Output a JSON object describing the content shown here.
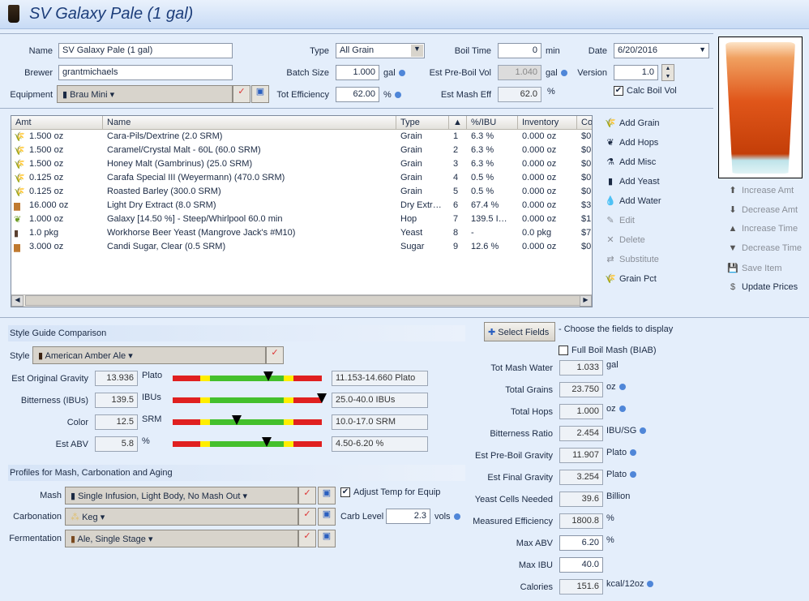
{
  "window": {
    "title": "SV Galaxy Pale (1 gal)",
    "icon": "beer-glass-icon"
  },
  "recipe": {
    "name_label": "Name",
    "name": "SV Galaxy Pale (1 gal)",
    "brewer_label": "Brewer",
    "brewer": "grantmichaels",
    "equipment_label": "Equipment",
    "equipment": "Brau Mini",
    "type_label": "Type",
    "type": "All Grain",
    "batch_label": "Batch Size",
    "batch": "1.000",
    "batch_unit": "gal",
    "eff_label": "Tot Efficiency",
    "eff": "62.00",
    "eff_unit": "%",
    "boil_label": "Boil Time",
    "boil": "0",
    "boil_unit": "min",
    "preboil_label": "Est Pre-Boil Vol",
    "preboil": "1.040",
    "preboil_unit": "gal",
    "mash_eff_label": "Est Mash Eff",
    "mash_eff": "62.0",
    "mash_eff_unit": "%",
    "date_label": "Date",
    "date": "6/20/2016",
    "version_label": "Version",
    "version": "1.0",
    "calc_boil_label": "Calc Boil Vol",
    "calc_boil": true
  },
  "grid": {
    "headers": [
      "Amt",
      "Name",
      "Type",
      "▲",
      "%/IBU",
      "Inventory",
      "Cost"
    ],
    "rows": [
      {
        "icon": "grain-icon",
        "amt": "1.500 oz",
        "name": "Cara-Pils/Dextrine (2.0 SRM)",
        "type": "Grain",
        "n": "1",
        "pct": "6.3 %",
        "inv": "0.000 oz",
        "cost": "$0."
      },
      {
        "icon": "grain-icon",
        "amt": "1.500 oz",
        "name": "Caramel/Crystal Malt - 60L (60.0 SRM)",
        "type": "Grain",
        "n": "2",
        "pct": "6.3 %",
        "inv": "0.000 oz",
        "cost": "$0."
      },
      {
        "icon": "grain-icon",
        "amt": "1.500 oz",
        "name": "Honey Malt (Gambrinus) (25.0 SRM)",
        "type": "Grain",
        "n": "3",
        "pct": "6.3 %",
        "inv": "0.000 oz",
        "cost": "$0."
      },
      {
        "icon": "grain-icon",
        "amt": "0.125 oz",
        "name": "Carafa Special III (Weyermann) (470.0 SRM)",
        "type": "Grain",
        "n": "4",
        "pct": "0.5 %",
        "inv": "0.000 oz",
        "cost": "$0."
      },
      {
        "icon": "grain-icon",
        "amt": "0.125 oz",
        "name": "Roasted Barley (300.0 SRM)",
        "type": "Grain",
        "n": "5",
        "pct": "0.5 %",
        "inv": "0.000 oz",
        "cost": "$0."
      },
      {
        "icon": "extract-bag-icon",
        "amt": "16.000 oz",
        "name": "Light Dry Extract (8.0 SRM)",
        "type": "Dry Extr…",
        "n": "6",
        "pct": "67.4 %",
        "inv": "0.000 oz",
        "cost": "$3."
      },
      {
        "icon": "hop-icon",
        "amt": "1.000 oz",
        "name": "Galaxy [14.50 %] - Steep/Whirlpool  60.0 min",
        "type": "Hop",
        "n": "7",
        "pct": "139.5 I…",
        "inv": "0.000 oz",
        "cost": "$1."
      },
      {
        "icon": "yeast-vial-icon",
        "amt": "1.0 pkg",
        "name": "Workhorse Beer Yeast (Mangrove Jack's #M10)",
        "type": "Yeast",
        "n": "8",
        "pct": "-",
        "inv": "0.0 pkg",
        "cost": "$7."
      },
      {
        "icon": "sugar-bag-icon",
        "amt": "3.000 oz",
        "name": "Candi Sugar, Clear (0.5 SRM)",
        "type": "Sugar",
        "n": "9",
        "pct": "12.6 %",
        "inv": "0.000 oz",
        "cost": "$0."
      }
    ]
  },
  "actions": [
    {
      "label": "Add Grain",
      "icon": "grain-icon",
      "glyph": "🌾",
      "enabled": true
    },
    {
      "label": "Add Hops",
      "icon": "hop-icon",
      "glyph": "❦",
      "enabled": true
    },
    {
      "label": "Add Misc",
      "icon": "misc-icon",
      "glyph": "⚗",
      "enabled": true
    },
    {
      "label": "Add Yeast",
      "icon": "yeast-vial-icon",
      "glyph": "▮",
      "enabled": true
    },
    {
      "label": "Add Water",
      "icon": "water-drop-icon",
      "glyph": "💧",
      "enabled": true
    },
    {
      "label": "Edit",
      "icon": "edit-icon",
      "glyph": "✎",
      "enabled": false
    },
    {
      "label": "Delete",
      "icon": "delete-x-icon",
      "glyph": "✕",
      "enabled": false
    },
    {
      "label": "Substitute",
      "icon": "substitute-arrows-icon",
      "glyph": "⇄",
      "enabled": false
    },
    {
      "label": "Grain Pct",
      "icon": "grain-icon",
      "glyph": "🌾",
      "enabled": true
    }
  ],
  "actions2": [
    {
      "label": "Increase Amt",
      "icon": "arrow-up-icon",
      "glyph": "⬆"
    },
    {
      "label": "Decrease Amt",
      "icon": "arrow-down-icon",
      "glyph": "⬇"
    },
    {
      "label": "Increase Time",
      "icon": "triangle-up-icon",
      "glyph": "▲"
    },
    {
      "label": "Decrease Time",
      "icon": "triangle-down-icon",
      "glyph": "▼"
    },
    {
      "label": "Save Item",
      "icon": "save-icon",
      "glyph": "💾"
    },
    {
      "label": "Update Prices",
      "icon": "dollar-icon",
      "glyph": "$"
    }
  ],
  "beer_color": "#e0561a",
  "style": {
    "section_title": "Style Guide Comparison",
    "style_label": "Style",
    "style": "American Amber Ale",
    "gauges": [
      {
        "label": "Est Original Gravity",
        "value": "13.936",
        "unit": "Plato",
        "range": "11.153-14.660 Plato",
        "v": 13.936,
        "min": 11.153,
        "max": 14.66
      },
      {
        "label": "Bitterness (IBUs)",
        "value": "139.5",
        "unit": "IBUs",
        "range": "25.0-40.0 IBUs",
        "v": 139.5,
        "min": 25,
        "max": 40
      },
      {
        "label": "Color",
        "value": "12.5",
        "unit": "SRM",
        "range": "10.0-17.0 SRM",
        "v": 12.5,
        "min": 10,
        "max": 17
      },
      {
        "label": "Est ABV",
        "value": "5.8",
        "unit": "%",
        "range": "4.50-6.20 %",
        "v": 5.8,
        "min": 4.5,
        "max": 6.2
      }
    ]
  },
  "profiles": {
    "section_title": "Profiles for Mash, Carbonation and Aging",
    "mash_label": "Mash",
    "mash": "Single Infusion, Light Body, No Mash Out",
    "carb_label": "Carbonation",
    "carb": "Keg",
    "ferm_label": "Fermentation",
    "ferm": "Ale, Single Stage",
    "adjust_label": "Adjust Temp for Equip",
    "adjust": true,
    "carb_level_label": "Carb Level",
    "carb_level": "2.3",
    "carb_level_unit": "vols"
  },
  "stats": {
    "select_fields": "Select Fields",
    "hint": "- Choose the fields to display",
    "biab_label": "Full Boil Mash (BIAB)",
    "biab": false,
    "fields": [
      {
        "label": "Tot Mash Water",
        "value": "1.033",
        "unit": "gal",
        "dot": false,
        "editable": false
      },
      {
        "label": "Total Grains",
        "value": "23.750",
        "unit": "oz",
        "dot": true,
        "editable": false
      },
      {
        "label": "Total Hops",
        "value": "1.000",
        "unit": "oz",
        "dot": true,
        "editable": false
      },
      {
        "label": "Bitterness Ratio",
        "value": "2.454",
        "unit": "IBU/SG",
        "dot": true,
        "editable": false
      },
      {
        "label": "Est Pre-Boil Gravity",
        "value": "11.907",
        "unit": "Plato",
        "dot": true,
        "editable": false
      },
      {
        "label": "Est Final Gravity",
        "value": "3.254",
        "unit": "Plato",
        "dot": true,
        "editable": false
      },
      {
        "label": "Yeast Cells Needed",
        "value": "39.6",
        "unit": "Billion",
        "dot": false,
        "editable": false
      },
      {
        "label": "Measured Efficiency",
        "value": "1800.8",
        "unit": "%",
        "dot": false,
        "editable": false
      },
      {
        "label": "Max ABV",
        "value": "6.20",
        "unit": "%",
        "dot": false,
        "editable": true
      },
      {
        "label": "Max IBU",
        "value": "40.0",
        "unit": "",
        "dot": false,
        "editable": true
      },
      {
        "label": "Calories",
        "value": "151.6",
        "unit": "kcal/12oz",
        "dot": true,
        "editable": false
      }
    ]
  }
}
